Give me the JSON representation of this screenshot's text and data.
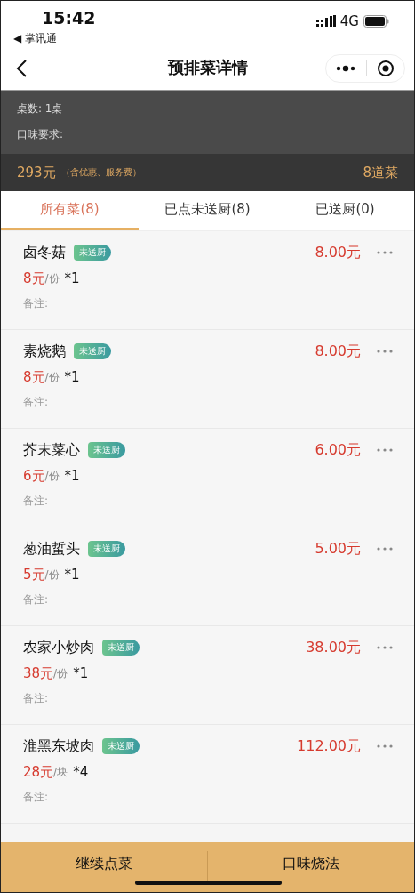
{
  "status_bar": {
    "time": "15:42",
    "back_app": "◀ 掌讯通",
    "network": "4G"
  },
  "nav": {
    "title": "预排菜详情"
  },
  "info": {
    "tables": "桌数: 1桌",
    "taste": "口味要求:"
  },
  "summary": {
    "total": "293元",
    "note": "（含优惠、服务费）",
    "count": "8道菜"
  },
  "tabs": [
    {
      "label": "所有菜(8)",
      "selected": true
    },
    {
      "label": "已点未送厨(8)",
      "selected": false
    },
    {
      "label": "已送厨(0)",
      "selected": false
    }
  ],
  "dishes": [
    {
      "name": "卤冬菇",
      "status": "未送厨",
      "unit_price": "8元",
      "unit": "/份",
      "quantity": "*1",
      "amount": "8.00元",
      "remark": "备注:"
    },
    {
      "name": "素烧鹅",
      "status": "未送厨",
      "unit_price": "8元",
      "unit": "/份",
      "quantity": "*1",
      "amount": "8.00元",
      "remark": "备注:"
    },
    {
      "name": "芥末菜心",
      "status": "未送厨",
      "unit_price": "6元",
      "unit": "/份",
      "quantity": "*1",
      "amount": "6.00元",
      "remark": "备注:"
    },
    {
      "name": "葱油蜇头",
      "status": "未送厨",
      "unit_price": "5元",
      "unit": "/份",
      "quantity": "*1",
      "amount": "5.00元",
      "remark": "备注:"
    },
    {
      "name": "农家小炒肉",
      "status": "未送厨",
      "unit_price": "38元",
      "unit": "/份",
      "quantity": "*1",
      "amount": "38.00元",
      "remark": "备注:"
    },
    {
      "name": "淮黑东坡肉",
      "status": "未送厨",
      "unit_price": "28元",
      "unit": "/块",
      "quantity": "*4",
      "amount": "112.00元",
      "remark": "备注:"
    }
  ],
  "bottom_buttons": [
    "继续点菜",
    "口味烧法"
  ]
}
